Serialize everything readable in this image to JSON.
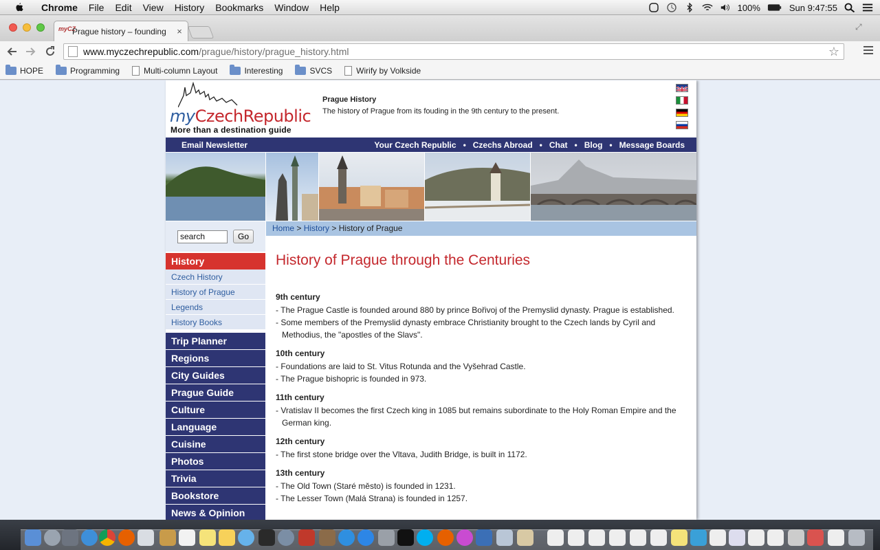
{
  "menubar": {
    "app": "Chrome",
    "menus": [
      "File",
      "Edit",
      "View",
      "History",
      "Bookmarks",
      "Window",
      "Help"
    ],
    "battery": "100%",
    "clock": "Sun 9:47:55"
  },
  "browser": {
    "tab_title": "Prague history – founding",
    "tab_favicon": "myCZ",
    "url_host": "www.myczechrepublic.com",
    "url_path": "/prague/history/prague_history.html",
    "bookmarks": [
      {
        "label": "HOPE",
        "icon": "folder-icon"
      },
      {
        "label": "Programming",
        "icon": "folder-icon"
      },
      {
        "label": "Multi-column Layout",
        "icon": "page-icon"
      },
      {
        "label": "Interesting",
        "icon": "folder-icon"
      },
      {
        "label": "SVCS",
        "icon": "folder-icon"
      },
      {
        "label": "Wirify by Volkside",
        "icon": "page-icon"
      }
    ]
  },
  "site": {
    "logo_my": "my",
    "logo_brand": "CzechRepublic",
    "logo_tagline": "More than a destination guide",
    "header_title": "Prague History",
    "header_desc": "The history of Prague from its fouding in the 9th century to the present.",
    "nav_left": "Email Newsletter",
    "nav_items": [
      "Your Czech Republic",
      "Czechs Abroad",
      "Chat",
      "Blog",
      "Message Boards"
    ],
    "search_value": "search",
    "search_button": "Go",
    "sidebar_active": "History",
    "sidebar_sub": [
      "Czech History",
      "History of Prague",
      "Legends",
      "History Books"
    ],
    "sidebar_main": [
      "Trip Planner",
      "Regions",
      "City Guides",
      "Prague Guide",
      "Culture",
      "Language",
      "Cuisine",
      "Photos",
      "Trivia",
      "Bookstore",
      "News & Opinion"
    ],
    "breadcrumb": {
      "home": "Home",
      "sep1": ">",
      "history": "History",
      "sep2": ">",
      "current": "History of Prague"
    },
    "page_title": "History of Prague through the Centuries",
    "centuries": [
      {
        "heading": "9th century",
        "items": [
          "- The Prague Castle is founded around 880 by prince Bořivoj of the Premyslid dynasty. Prague is established.",
          "- Some members of the Premyslid dynasty embrace Christianity brought to the Czech lands by Cyril and Methodius, the \"apostles of the Slavs\"."
        ]
      },
      {
        "heading": "10th century",
        "items": [
          "- Foundations are laid to St. Vitus Rotunda and the Vyšehrad Castle.",
          "- The Prague bishopric is founded in 973."
        ]
      },
      {
        "heading": "11th century",
        "items": [
          "- Vratislav II becomes the first Czech king in 1085 but remains subordinate to the Holy Roman Empire and the German king."
        ]
      },
      {
        "heading": "12th century",
        "items": [
          "- The first stone bridge over the Vltava, Judith Bridge, is built in 1172."
        ]
      },
      {
        "heading": "13th century",
        "items": [
          "- The Old Town (Staré město) is founded in 1231.",
          "- The Lesser Town (Malá Strana) is founded in 1257."
        ]
      }
    ]
  },
  "colors": {
    "nav_blue": "#2e3573",
    "accent_red": "#c4282d",
    "crumb_blue": "#a9c4e2",
    "link_blue": "#2e5d9f"
  }
}
